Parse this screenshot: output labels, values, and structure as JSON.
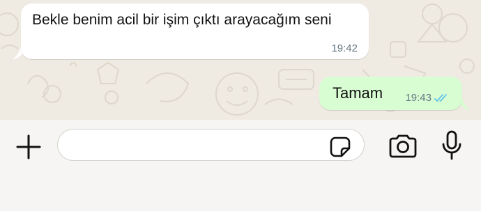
{
  "conversation": {
    "messages": [
      {
        "direction": "incoming",
        "text": "Bekle benim acil bir işim çıktı arayacağım seni",
        "time": "19:42"
      },
      {
        "direction": "outgoing",
        "text": "Tamam",
        "time": "19:43",
        "status": "read-double-check"
      }
    ]
  },
  "composer": {
    "input_value": "",
    "icons": {
      "attach": "plus-icon",
      "sticker": "sticker-icon",
      "camera": "camera-icon",
      "voice": "microphone-icon"
    }
  },
  "colors": {
    "chat_background": "#efeae2",
    "incoming_bubble": "#ffffff",
    "outgoing_bubble": "#d9fdd3",
    "timestamp": "#667781",
    "read_ticks": "#53bdeb",
    "input_bar": "#f6f5f3"
  }
}
